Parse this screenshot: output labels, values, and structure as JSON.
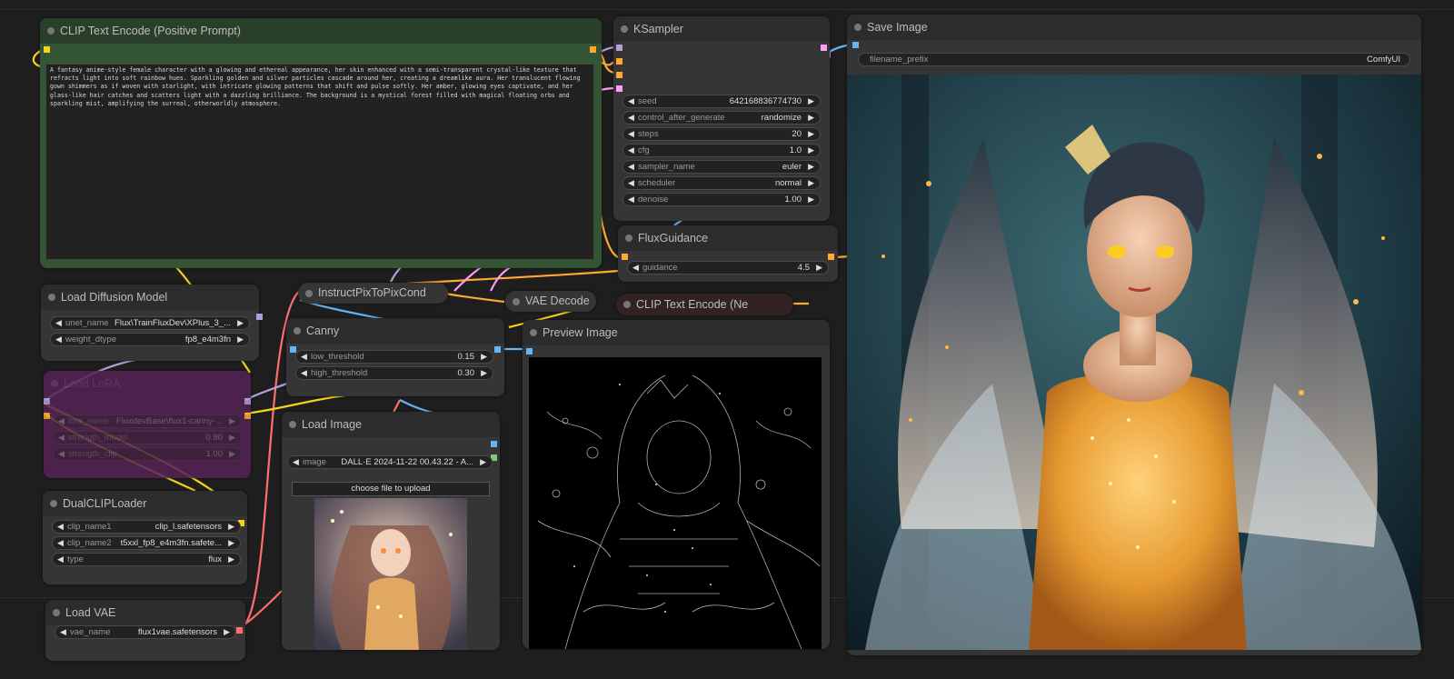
{
  "nodes": {
    "clip_positive": {
      "title": "CLIP Text Encode (Positive Prompt)",
      "text": "A fantasy anime-style female character with a glowing and ethereal appearance, her skin enhanced with a semi-transparent crystal-like texture that refracts light into soft rainbow hues. Sparkling golden and silver particles cascade around her, creating a dreamlike aura. Her translucent flowing gown shimmers as if woven with starlight, with intricate glowing patterns that shift and pulse softly. Her amber, glowing eyes captivate, and her glass-like hair catches and scatters light with a dazzling brilliance. The background is a mystical forest filled with magical floating orbs and sparkling mist, amplifying the surreal, otherworldly atmosphere."
    },
    "ksampler": {
      "title": "KSampler",
      "widgets": [
        {
          "label": "seed",
          "value": "642168836774730"
        },
        {
          "label": "control_after_generate",
          "value": "randomize"
        },
        {
          "label": "steps",
          "value": "20"
        },
        {
          "label": "cfg",
          "value": "1.0"
        },
        {
          "label": "sampler_name",
          "value": "euler"
        },
        {
          "label": "scheduler",
          "value": "normal"
        },
        {
          "label": "denoise",
          "value": "1.00"
        }
      ]
    },
    "save_image": {
      "title": "Save Image",
      "filename_prefix_label": "filename_prefix",
      "filename_prefix_value": "ComfyUI"
    },
    "flux_guidance": {
      "title": "FluxGuidance",
      "widgets": [
        {
          "label": "guidance",
          "value": "4.5"
        }
      ]
    },
    "load_diffusion": {
      "title": "Load Diffusion Model",
      "widgets": [
        {
          "label": "unet_name",
          "value": "Flux\\TrainFluxDev\\XPlus_3_..."
        },
        {
          "label": "weight_dtype",
          "value": "fp8_e4m3fn"
        }
      ]
    },
    "load_lora": {
      "title": "Load LoRA",
      "widgets": [
        {
          "label": "lora_name",
          "value": "FluxdevBase\\flux1-canny-..."
        },
        {
          "label": "strength_model",
          "value": "0.80"
        },
        {
          "label": "strength_clip",
          "value": "1.00"
        }
      ]
    },
    "dual_clip": {
      "title": "DualCLIPLoader",
      "widgets": [
        {
          "label": "clip_name1",
          "value": "clip_l.safetensors"
        },
        {
          "label": "clip_name2",
          "value": "t5xxl_fp8_e4m3fn.safete..."
        },
        {
          "label": "type",
          "value": "flux"
        }
      ]
    },
    "load_vae": {
      "title": "Load VAE",
      "widgets": [
        {
          "label": "vae_name",
          "value": "flux1vae.safetensors"
        }
      ]
    },
    "instruct_pix": {
      "title": "InstructPixToPixCond"
    },
    "vae_decode": {
      "title": "VAE Decode"
    },
    "clip_negative": {
      "title": "CLIP Text Encode (Ne"
    },
    "canny": {
      "title": "Canny",
      "widgets": [
        {
          "label": "low_threshold",
          "value": "0.15"
        },
        {
          "label": "high_threshold",
          "value": "0.30"
        }
      ]
    },
    "load_image": {
      "title": "Load Image",
      "widgets": [
        {
          "label": "image",
          "value": "DALL·E 2024-11-22 00.43.22 - A..."
        }
      ],
      "upload_label": "choose file to upload"
    },
    "preview_image": {
      "title": "Preview Image"
    }
  },
  "icons": {
    "arrow_left": "◀",
    "arrow_right": "▶"
  },
  "colors": {
    "clip_slot": "#f5d31a",
    "conditioning": "#ffa931",
    "model": "#b39ddb",
    "latent": "#ff9cf9",
    "image": "#64b5f6",
    "vae": "#ff6e6e",
    "mask": "#81c784",
    "positive_node_bg": "#335533",
    "lora_node_bg": "#552255",
    "negative_node_bg": "#332222"
  }
}
